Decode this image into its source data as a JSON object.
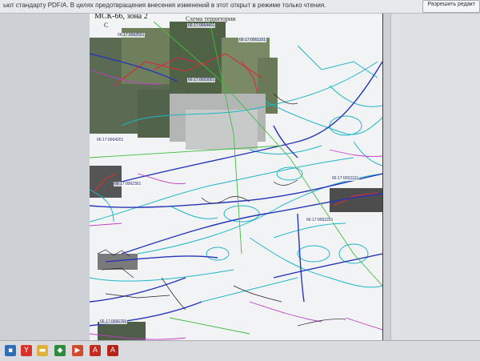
{
  "window": {
    "title": "ьют стандарту PDF/A. В целях предотвращения внесения изменений в этот открыт в режиме только чтения.",
    "edit_button": "Разрешить редакт"
  },
  "map": {
    "heading": "Схема территории",
    "zone": "МСК-66, зона 2",
    "north": "С",
    "parcels": [
      {
        "id": "p1",
        "label": "66:17:0062501"
      },
      {
        "id": "p2",
        "label": "66:17:0064401"
      },
      {
        "id": "p3",
        "label": "66:17:0061101"
      },
      {
        "id": "p4",
        "label": "66:17:0063001"
      },
      {
        "id": "p5",
        "label": "66:17:0064201"
      },
      {
        "id": "p6",
        "label": "66:17:0062301"
      },
      {
        "id": "p7",
        "label": "66:17:0063101"
      },
      {
        "id": "p8",
        "label": "66:17:0062201"
      },
      {
        "id": "p9",
        "label": "66:17:0066701"
      }
    ]
  },
  "taskbar": {
    "icons": [
      {
        "name": "windows-icon",
        "glyph": "▪",
        "color": "#2f6db5"
      },
      {
        "name": "yandex-browser-icon",
        "glyph": "Y",
        "color": "#d8332a"
      },
      {
        "name": "file-explorer-icon",
        "glyph": "▬",
        "color": "#e0b23b"
      },
      {
        "name": "antivirus-shield-icon",
        "glyph": "◆",
        "color": "#2e8b3e"
      },
      {
        "name": "media-player-icon",
        "glyph": "▶",
        "color": "#cf4b2a"
      },
      {
        "name": "adobe-acrobat-icon",
        "glyph": "A",
        "color": "#c52b21"
      },
      {
        "name": "pdf-document-icon",
        "glyph": "A",
        "color": "#b52319"
      }
    ]
  }
}
